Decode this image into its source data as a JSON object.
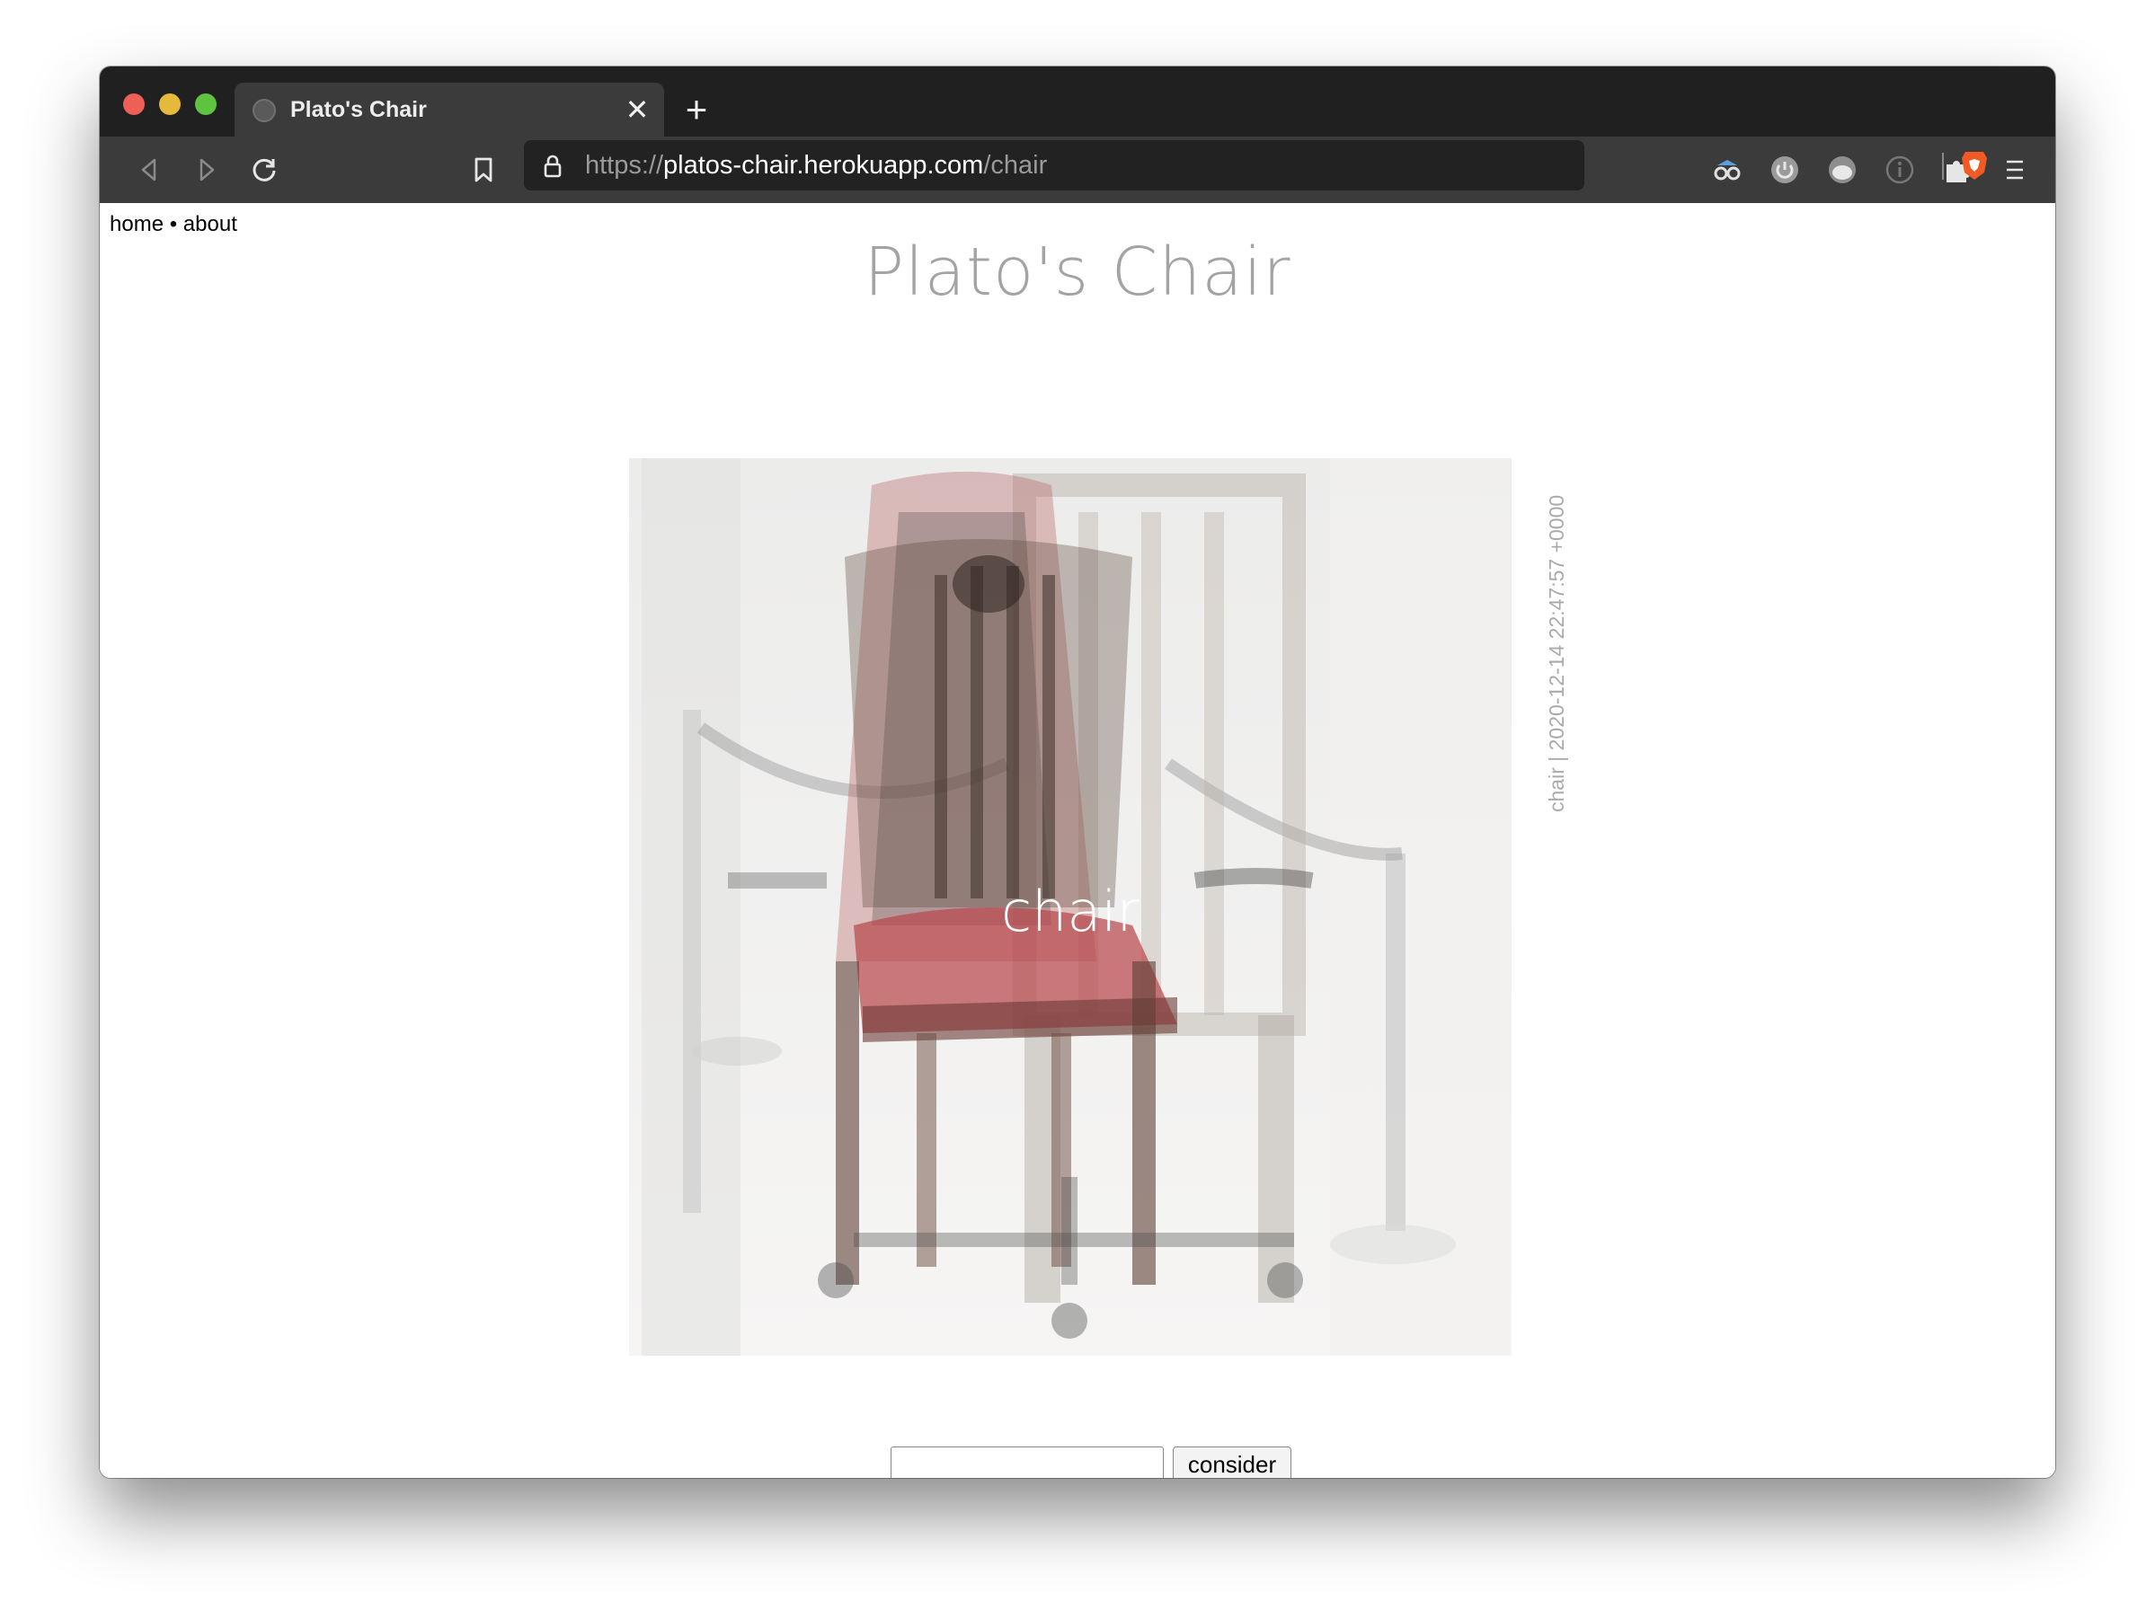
{
  "browser": {
    "tab_title": "Plato's Chair",
    "url_prefix": "https://",
    "url_domain": "platos-chair.herokuapp.com",
    "url_path": "/chair"
  },
  "nav": {
    "home_label": "home",
    "separator": "•",
    "about_label": "about"
  },
  "page": {
    "title": "Plato's Chair",
    "image_overlay_label": "chair",
    "caption": "chair | 2020-12-14 22:47:57 +0000"
  },
  "form": {
    "input_value": "",
    "button_label": "consider"
  },
  "colors": {
    "accent_red": "#c94a4c",
    "title_gray": "#a3a3a3"
  },
  "icons": [
    "back-icon",
    "forward-icon",
    "reload-icon",
    "bookmark-icon",
    "lock-icon",
    "brave-shield-icon",
    "extension-1-icon",
    "extension-2-icon",
    "extension-3-icon",
    "extension-4-icon",
    "puzzle-icon",
    "menu-icon"
  ]
}
